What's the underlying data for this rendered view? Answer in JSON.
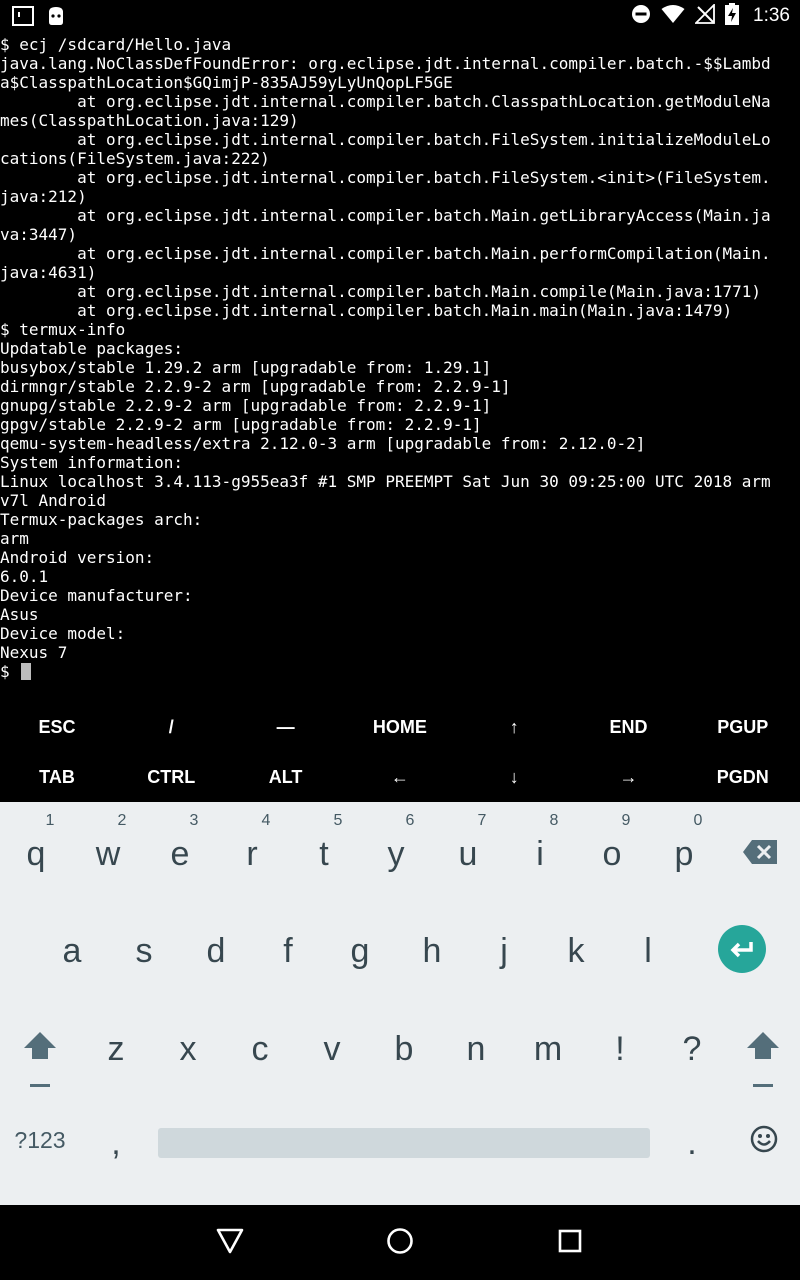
{
  "status_bar": {
    "time": "1:36",
    "left_icons": [
      "terminal-notification-icon",
      "android-icon"
    ],
    "right_icons": [
      "do-not-disturb-icon",
      "wifi-icon",
      "no-signal-icon",
      "battery-charging-icon"
    ]
  },
  "terminal": {
    "lines": [
      "$ ecj /sdcard/Hello.java",
      "java.lang.NoClassDefFoundError: org.eclipse.jdt.internal.compiler.batch.-$$Lambd",
      "a$ClasspathLocation$GQimjP-835AJ59yLyUnQopLF5GE",
      "        at org.eclipse.jdt.internal.compiler.batch.ClasspathLocation.getModuleNa",
      "mes(ClasspathLocation.java:129)",
      "        at org.eclipse.jdt.internal.compiler.batch.FileSystem.initializeModuleLo",
      "cations(FileSystem.java:222)",
      "        at org.eclipse.jdt.internal.compiler.batch.FileSystem.<init>(FileSystem.",
      "java:212)",
      "        at org.eclipse.jdt.internal.compiler.batch.Main.getLibraryAccess(Main.ja",
      "va:3447)",
      "        at org.eclipse.jdt.internal.compiler.batch.Main.performCompilation(Main.",
      "java:4631)",
      "        at org.eclipse.jdt.internal.compiler.batch.Main.compile(Main.java:1771)",
      "        at org.eclipse.jdt.internal.compiler.batch.Main.main(Main.java:1479)",
      "$ termux-info",
      "Updatable packages:",
      "busybox/stable 1.29.2 arm [upgradable from: 1.29.1]",
      "dirmngr/stable 2.2.9-2 arm [upgradable from: 2.2.9-1]",
      "gnupg/stable 2.2.9-2 arm [upgradable from: 2.2.9-1]",
      "gpgv/stable 2.2.9-2 arm [upgradable from: 2.2.9-1]",
      "qemu-system-headless/extra 2.12.0-3 arm [upgradable from: 2.12.0-2]",
      "System information:",
      "Linux localhost 3.4.113-g955ea3f #1 SMP PREEMPT Sat Jun 30 09:25:00 UTC 2018 arm",
      "v7l Android",
      "Termux-packages arch:",
      "arm",
      "Android version:",
      "6.0.1",
      "Device manufacturer:",
      "Asus",
      "Device model:",
      "Nexus 7"
    ],
    "prompt": "$ "
  },
  "extra_keys": {
    "row1": [
      "ESC",
      "/",
      "—",
      "HOME",
      "↑",
      "END",
      "PGUP"
    ],
    "row2": [
      "TAB",
      "CTRL",
      "ALT",
      "←",
      "↓",
      "→",
      "PGDN"
    ]
  },
  "keyboard": {
    "row1": [
      {
        "letter": "q",
        "hint": "1"
      },
      {
        "letter": "w",
        "hint": "2"
      },
      {
        "letter": "e",
        "hint": "3"
      },
      {
        "letter": "r",
        "hint": "4"
      },
      {
        "letter": "t",
        "hint": "5"
      },
      {
        "letter": "y",
        "hint": "6"
      },
      {
        "letter": "u",
        "hint": "7"
      },
      {
        "letter": "i",
        "hint": "8"
      },
      {
        "letter": "o",
        "hint": "9"
      },
      {
        "letter": "p",
        "hint": "0"
      }
    ],
    "row2": [
      "a",
      "s",
      "d",
      "f",
      "g",
      "h",
      "j",
      "k",
      "l"
    ],
    "row3": [
      "z",
      "x",
      "c",
      "v",
      "b",
      "n",
      "m",
      "!",
      "?"
    ],
    "symbols_label": "?123",
    "comma": ",",
    "period": ".",
    "accent_color": "#26a69a",
    "key_color": "#37474f"
  },
  "nav_bar": {
    "buttons": [
      "back-icon",
      "home-icon",
      "recents-icon"
    ]
  }
}
